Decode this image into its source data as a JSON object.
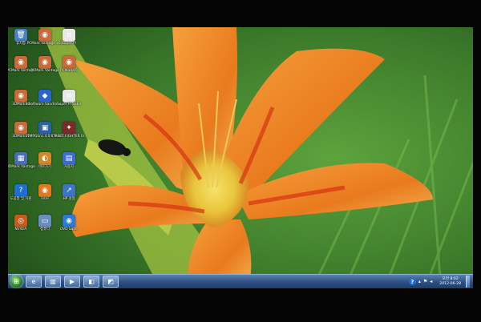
{
  "desktop": {
    "icons": [
      {
        "id": "recycle-bin",
        "label": "휴지통",
        "glyph": "🗑",
        "color": "#4a7fc1"
      },
      {
        "id": "pcmark-vantage-x64",
        "label": "PCMark Vantage x64",
        "glyph": "◉",
        "color": "#c86a3a"
      },
      {
        "id": "super-pi-1",
        "label": "Super PI",
        "glyph": "π",
        "color": "#e9e9e9"
      },
      {
        "id": "pcmark-vantage",
        "label": "PCMark Vantage",
        "glyph": "◉",
        "color": "#c86a3a"
      },
      {
        "id": "pcmark-vantage-2",
        "label": "PCMark Vantage",
        "glyph": "◉",
        "color": "#c86a3a"
      },
      {
        "id": "pcmark05",
        "label": "PCMark05",
        "glyph": "◉",
        "color": "#c86a3a"
      },
      {
        "id": "3dmark05",
        "label": "3DMark05",
        "glyph": "◉",
        "color": "#c86a3a"
      },
      {
        "id": "sisoftware-sandra",
        "label": "SiSoftware Sandra Li...",
        "glyph": "◆",
        "color": "#2a66c8"
      },
      {
        "id": "super-pi-sse3",
        "label": "Super PI SSE3",
        "glyph": "π",
        "color": "#e9e9e9"
      },
      {
        "id": "3dmark06",
        "label": "3DMark06",
        "glyph": "◉",
        "color": "#c86a3a"
      },
      {
        "id": "tmpgenc",
        "label": "TMPGEnc 4.0 XPress",
        "glyph": "▣",
        "color": "#2d5ea8"
      },
      {
        "id": "street-fighter",
        "label": "STREET FIGHTER IV...",
        "glyph": "✦",
        "color": "#7a2a2a"
      },
      {
        "id": "icon-row5-1",
        "label": "3DMark Vantage",
        "glyph": "▦",
        "color": "#4b6fb5"
      },
      {
        "id": "icon-row5-2",
        "label": "바로가기",
        "glyph": "◐",
        "color": "#d08a2a"
      },
      {
        "id": "icon-row5-3",
        "label": "사용자",
        "glyph": "▤",
        "color": "#3a6ed0"
      },
      {
        "id": "help-support",
        "label": "도움말 및 지원",
        "glyph": "?",
        "color": "#1f6fd1"
      },
      {
        "id": "icon-row6-2",
        "label": "Intel",
        "glyph": "◉",
        "color": "#e07a1a"
      },
      {
        "id": "hp-icon",
        "label": "HP 설정",
        "glyph": "↗",
        "color": "#3b75c4"
      },
      {
        "id": "icon-row7-2",
        "label": "NVIDIA",
        "glyph": "◎",
        "color": "#c85a1a"
      },
      {
        "id": "computer-icon",
        "label": "컴퓨터",
        "glyph": "▭",
        "color": "#6a8fbf"
      },
      {
        "id": "icon-row8-2",
        "label": "DVD Suite",
        "glyph": "◉",
        "color": "#2a7ad8"
      }
    ]
  },
  "taskbar": {
    "start_glyph": "⊞",
    "pinned": [
      {
        "id": "ie",
        "glyph": "e"
      },
      {
        "id": "explorer",
        "glyph": "▥"
      },
      {
        "id": "media-player",
        "glyph": "▶"
      },
      {
        "id": "app-4",
        "glyph": "◧"
      },
      {
        "id": "app-5",
        "glyph": "◩"
      }
    ],
    "tray": {
      "help_glyph": "?",
      "clock_time": "오전 8:02",
      "clock_date": "2012-06-28"
    }
  }
}
